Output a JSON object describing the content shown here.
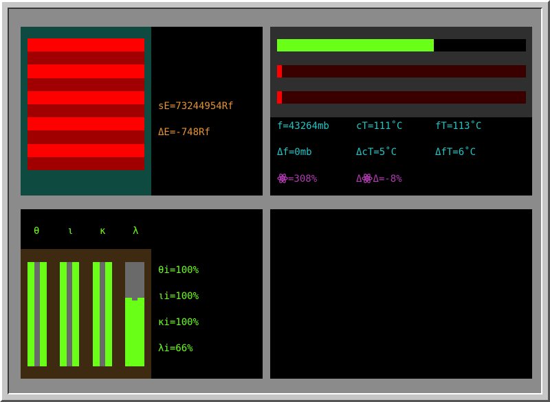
{
  "colors": {
    "energy_bg": "#0f4a40",
    "stripe_light": "#ff0000",
    "stripe_dark": "#a00000",
    "orange": "#e6922e",
    "cyan": "#23c4c4",
    "magenta": "#b23ab2",
    "green": "#6aff16",
    "bar_track": "#3a0000",
    "bar_track_green": "#000000",
    "bar_panel": "#2f2f2f",
    "cell_bg": "#3e2a10",
    "cell_fill": "#6aff16"
  },
  "energy": {
    "stored": "sE=73244954Rf",
    "delta": "ΔE=-748Rf",
    "stripe_count": 10
  },
  "gauges": {
    "bars": [
      {
        "fraction": 0.63
      },
      {
        "fraction": 0.02
      },
      {
        "fraction": 0.02
      }
    ],
    "stats": {
      "f": "f=43264mb",
      "cT": "cT=111˚C",
      "fT": "fT=113˚C",
      "df": "Δf=0mb",
      "dcT": "ΔcT=5˚C",
      "dfT": "ΔfT=6˚C",
      "rad": "=308%",
      "drad": "Δ=-8%"
    },
    "rad_icon": "atom-icon"
  },
  "cells": {
    "labels": [
      "θ",
      "ι",
      "κ",
      "λ"
    ],
    "fractions": [
      1.0,
      1.0,
      1.0,
      0.66
    ],
    "readouts": [
      "θi=100%",
      "ιi=100%",
      "κi=100%",
      "λi=66%"
    ]
  }
}
